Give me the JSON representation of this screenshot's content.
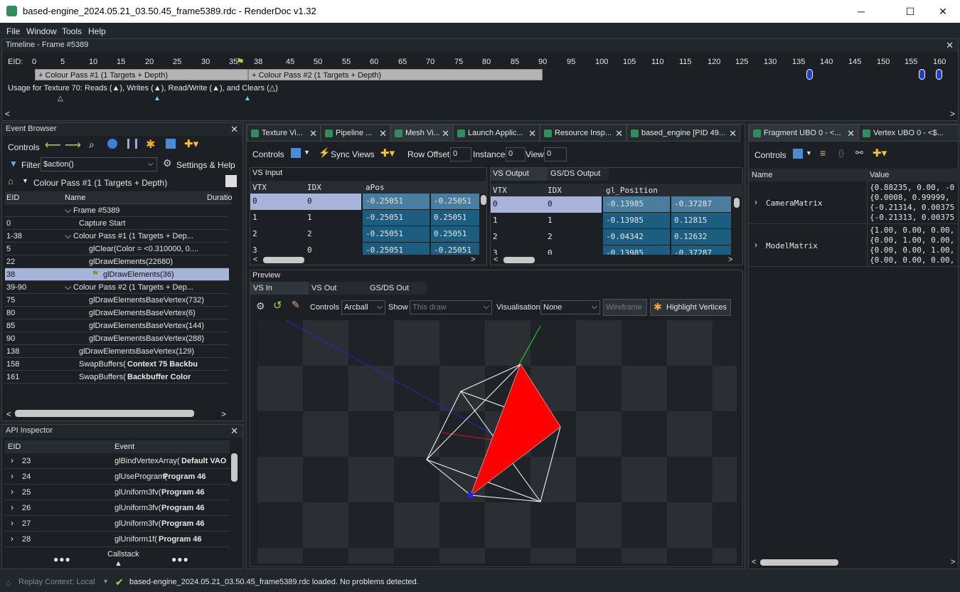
{
  "window": {
    "title": "based-engine_2024.05.21_03.50.45_frame5389.rdc - RenderDoc v1.32",
    "minimize": "─",
    "maximize": "☐",
    "close": "✕"
  },
  "menu": [
    "File",
    "Window",
    "Tools",
    "Help"
  ],
  "timeline": {
    "title": "Timeline - Frame #5389",
    "eid_label": "EID:",
    "ticks": [
      "0",
      "5",
      "10",
      "15",
      "20",
      "25",
      "30",
      "35",
      "38",
      "45",
      "50",
      "55",
      "60",
      "65",
      "70",
      "75",
      "80",
      "85",
      "90",
      "95",
      "100",
      "105",
      "110",
      "115",
      "120",
      "125",
      "130",
      "135",
      "140",
      "145",
      "150",
      "155",
      "160"
    ],
    "pass1": "+ Colour Pass #1 (1 Targets + Depth)",
    "pass2": "+ Colour Pass #2 (1 Targets + Depth)",
    "usage": "Usage for Texture 70: Reads (▲), Writes (▲), Read/Write (▲), and Clears (△)"
  },
  "event_browser": {
    "title": "Event Browser",
    "controls_label": "Controls",
    "filter_label": "Filter",
    "filter_value": "$action()",
    "settings_label": "Settings & Help",
    "breadcrumb": "Colour Pass #1 (1 Targets + Depth)",
    "columns": [
      "EID",
      "Name",
      "Duratio"
    ],
    "rows": [
      {
        "eid": "",
        "name": "Frame #5389",
        "indent": 0,
        "arrow": "⌵"
      },
      {
        "eid": "0",
        "name": "Capture Start",
        "indent": 1,
        "arrow": ""
      },
      {
        "eid": "1-38",
        "name": "Colour Pass #1 (1 Targets + Dep...",
        "indent": 0,
        "arrow": "⌵"
      },
      {
        "eid": "5",
        "name": "glClear(Color = <0.310000, 0....",
        "indent": 2,
        "arrow": ""
      },
      {
        "eid": "22",
        "name": "glDrawElements(22680)",
        "indent": 2,
        "arrow": ""
      },
      {
        "eid": "38",
        "name": "glDrawElements(36)",
        "indent": 3,
        "arrow": ""
      },
      {
        "eid": "39-90",
        "name": "Colour Pass #2 (1 Targets + Dep...",
        "indent": 0,
        "arrow": "⌵"
      },
      {
        "eid": "75",
        "name": "glDrawElementsBaseVertex(732)",
        "indent": 2,
        "arrow": ""
      },
      {
        "eid": "80",
        "name": "glDrawElementsBaseVertex(6)",
        "indent": 2,
        "arrow": ""
      },
      {
        "eid": "85",
        "name": "glDrawElementsBaseVertex(144)",
        "indent": 2,
        "arrow": ""
      },
      {
        "eid": "90",
        "name": "glDrawElementsBaseVertex(288)",
        "indent": 2,
        "arrow": ""
      },
      {
        "eid": "138",
        "name": "glDrawElementsBaseVertex(129)",
        "indent": -1,
        "arrow": ""
      },
      {
        "eid": "158",
        "name": "SwapBuffers(",
        "bold": "Context 75 Backbu",
        "indent": -1,
        "arrow": ""
      },
      {
        "eid": "161",
        "name": "SwapBuffers(",
        "bold": "Backbuffer Color",
        "indent": -1,
        "arrow": ""
      }
    ]
  },
  "api_inspector": {
    "title": "API Inspector",
    "columns": [
      "EID",
      "Event"
    ],
    "rows": [
      {
        "eid": "23",
        "fn": "glBindVertexArray(",
        "arg": "Default VAO"
      },
      {
        "eid": "24",
        "fn": "glUseProgram(",
        "arg": "Program 46"
      },
      {
        "eid": "25",
        "fn": "glUniform3fv(",
        "arg": "Program 46"
      },
      {
        "eid": "26",
        "fn": "glUniform3fv(",
        "arg": "Program 46"
      },
      {
        "eid": "27",
        "fn": "glUniform3fv(",
        "arg": "Program 46"
      },
      {
        "eid": "28",
        "fn": "glUniform1f(",
        "arg": "Program 46"
      }
    ],
    "callstack": "Callstack",
    "dots": "●●●"
  },
  "center_tabs": [
    "Texture Vi...",
    "Pipeline ...",
    "Mesh Vi...",
    "Launch Applic...",
    "Resource Insp...",
    "based_engine [PID 49..."
  ],
  "mesh": {
    "controls_label": "Controls",
    "sync_views": "Sync Views",
    "row_offset_label": "Row Offset",
    "row_offset": "0",
    "instance_label": "Instance",
    "instance": "0",
    "view_label": "View",
    "view": "0",
    "vs_input": {
      "title": "VS Input",
      "columns": [
        "VTX",
        "IDX",
        "aPos",
        ""
      ],
      "rows": [
        [
          "0",
          "0",
          "-0.25051",
          "-0.25051"
        ],
        [
          "1",
          "1",
          "-0.25051",
          "0.25051"
        ],
        [
          "2",
          "2",
          "-0.25051",
          "0.25051"
        ],
        [
          "3",
          "0",
          "-0.25051",
          "-0.25051"
        ]
      ]
    },
    "vs_output": {
      "tab1": "VS Output",
      "tab2": "GS/DS Output",
      "columns": [
        "VTX",
        "IDX",
        "gl_Position",
        ""
      ],
      "rows": [
        [
          "0",
          "0",
          "-0.13985",
          "-0.37287"
        ],
        [
          "1",
          "1",
          "-0.13985",
          "0.12815"
        ],
        [
          "2",
          "2",
          "-0.04342",
          "0.12632"
        ],
        [
          "3",
          "0",
          "-0.13985",
          "-0.37287"
        ]
      ]
    },
    "preview": {
      "title": "Preview",
      "tabs": [
        "VS In",
        "VS Out",
        "GS/DS Out"
      ],
      "controls_label": "Controls",
      "controls_value": "Arcball",
      "show_label": "Show",
      "show_value": "This draw",
      "vis_label": "Visualisation",
      "vis_value": "None",
      "wireframe": "Wireframe",
      "highlight": "Highlight Vertices"
    }
  },
  "right": {
    "tab1": "Fragment UBO 0 - <...",
    "tab2": "Vertex UBO 0 - <$...",
    "controls_label": "Controls",
    "columns": [
      "Name",
      "Value"
    ],
    "rows": [
      {
        "name": "CameraMatrix",
        "values": [
          "{0.88235, 0.00, -0",
          "{0.0008, 0.99999,",
          "{-0.21314, 0.00375",
          "{-0.21313, 0.00375"
        ]
      },
      {
        "name": "ModelMatrix",
        "values": [
          "{1.00, 0.00, 0.00,",
          "{0.00, 1.00, 0.00,",
          "{0.00, 0.00, 1.00,",
          "{0.00, 0.00, 0.00,"
        ]
      }
    ]
  },
  "status": {
    "replay": "Replay Context: Local",
    "message": "based-engine_2024.05.21_03.50.45_frame5389.rdc loaded. No problems detected."
  }
}
